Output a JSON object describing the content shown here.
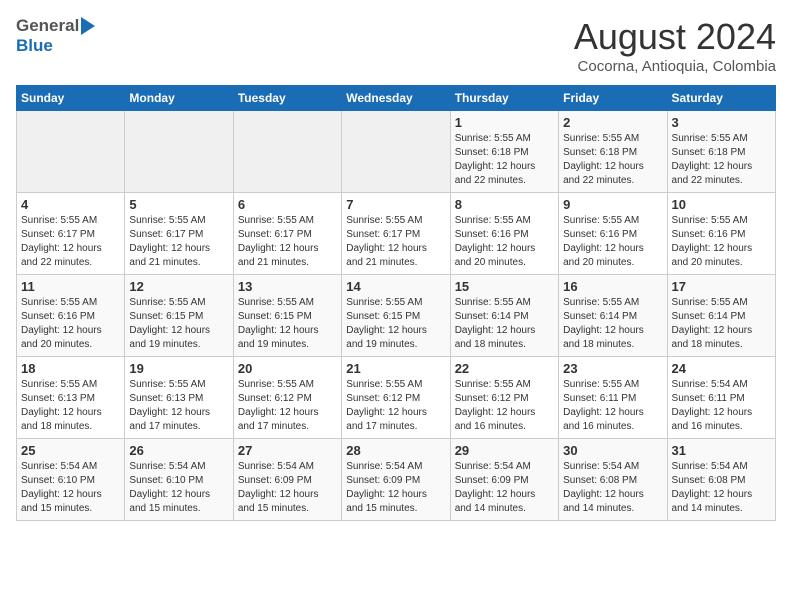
{
  "header": {
    "logo_general": "General",
    "logo_blue": "Blue",
    "month_title": "August 2024",
    "location": "Cocorna, Antioquia, Colombia"
  },
  "days_of_week": [
    "Sunday",
    "Monday",
    "Tuesday",
    "Wednesday",
    "Thursday",
    "Friday",
    "Saturday"
  ],
  "weeks": [
    [
      {
        "day": "",
        "info": ""
      },
      {
        "day": "",
        "info": ""
      },
      {
        "day": "",
        "info": ""
      },
      {
        "day": "",
        "info": ""
      },
      {
        "day": "1",
        "info": "Sunrise: 5:55 AM\nSunset: 6:18 PM\nDaylight: 12 hours\nand 22 minutes."
      },
      {
        "day": "2",
        "info": "Sunrise: 5:55 AM\nSunset: 6:18 PM\nDaylight: 12 hours\nand 22 minutes."
      },
      {
        "day": "3",
        "info": "Sunrise: 5:55 AM\nSunset: 6:18 PM\nDaylight: 12 hours\nand 22 minutes."
      }
    ],
    [
      {
        "day": "4",
        "info": "Sunrise: 5:55 AM\nSunset: 6:17 PM\nDaylight: 12 hours\nand 22 minutes."
      },
      {
        "day": "5",
        "info": "Sunrise: 5:55 AM\nSunset: 6:17 PM\nDaylight: 12 hours\nand 21 minutes."
      },
      {
        "day": "6",
        "info": "Sunrise: 5:55 AM\nSunset: 6:17 PM\nDaylight: 12 hours\nand 21 minutes."
      },
      {
        "day": "7",
        "info": "Sunrise: 5:55 AM\nSunset: 6:17 PM\nDaylight: 12 hours\nand 21 minutes."
      },
      {
        "day": "8",
        "info": "Sunrise: 5:55 AM\nSunset: 6:16 PM\nDaylight: 12 hours\nand 20 minutes."
      },
      {
        "day": "9",
        "info": "Sunrise: 5:55 AM\nSunset: 6:16 PM\nDaylight: 12 hours\nand 20 minutes."
      },
      {
        "day": "10",
        "info": "Sunrise: 5:55 AM\nSunset: 6:16 PM\nDaylight: 12 hours\nand 20 minutes."
      }
    ],
    [
      {
        "day": "11",
        "info": "Sunrise: 5:55 AM\nSunset: 6:16 PM\nDaylight: 12 hours\nand 20 minutes."
      },
      {
        "day": "12",
        "info": "Sunrise: 5:55 AM\nSunset: 6:15 PM\nDaylight: 12 hours\nand 19 minutes."
      },
      {
        "day": "13",
        "info": "Sunrise: 5:55 AM\nSunset: 6:15 PM\nDaylight: 12 hours\nand 19 minutes."
      },
      {
        "day": "14",
        "info": "Sunrise: 5:55 AM\nSunset: 6:15 PM\nDaylight: 12 hours\nand 19 minutes."
      },
      {
        "day": "15",
        "info": "Sunrise: 5:55 AM\nSunset: 6:14 PM\nDaylight: 12 hours\nand 18 minutes."
      },
      {
        "day": "16",
        "info": "Sunrise: 5:55 AM\nSunset: 6:14 PM\nDaylight: 12 hours\nand 18 minutes."
      },
      {
        "day": "17",
        "info": "Sunrise: 5:55 AM\nSunset: 6:14 PM\nDaylight: 12 hours\nand 18 minutes."
      }
    ],
    [
      {
        "day": "18",
        "info": "Sunrise: 5:55 AM\nSunset: 6:13 PM\nDaylight: 12 hours\nand 18 minutes."
      },
      {
        "day": "19",
        "info": "Sunrise: 5:55 AM\nSunset: 6:13 PM\nDaylight: 12 hours\nand 17 minutes."
      },
      {
        "day": "20",
        "info": "Sunrise: 5:55 AM\nSunset: 6:12 PM\nDaylight: 12 hours\nand 17 minutes."
      },
      {
        "day": "21",
        "info": "Sunrise: 5:55 AM\nSunset: 6:12 PM\nDaylight: 12 hours\nand 17 minutes."
      },
      {
        "day": "22",
        "info": "Sunrise: 5:55 AM\nSunset: 6:12 PM\nDaylight: 12 hours\nand 16 minutes."
      },
      {
        "day": "23",
        "info": "Sunrise: 5:55 AM\nSunset: 6:11 PM\nDaylight: 12 hours\nand 16 minutes."
      },
      {
        "day": "24",
        "info": "Sunrise: 5:54 AM\nSunset: 6:11 PM\nDaylight: 12 hours\nand 16 minutes."
      }
    ],
    [
      {
        "day": "25",
        "info": "Sunrise: 5:54 AM\nSunset: 6:10 PM\nDaylight: 12 hours\nand 15 minutes."
      },
      {
        "day": "26",
        "info": "Sunrise: 5:54 AM\nSunset: 6:10 PM\nDaylight: 12 hours\nand 15 minutes."
      },
      {
        "day": "27",
        "info": "Sunrise: 5:54 AM\nSunset: 6:09 PM\nDaylight: 12 hours\nand 15 minutes."
      },
      {
        "day": "28",
        "info": "Sunrise: 5:54 AM\nSunset: 6:09 PM\nDaylight: 12 hours\nand 15 minutes."
      },
      {
        "day": "29",
        "info": "Sunrise: 5:54 AM\nSunset: 6:09 PM\nDaylight: 12 hours\nand 14 minutes."
      },
      {
        "day": "30",
        "info": "Sunrise: 5:54 AM\nSunset: 6:08 PM\nDaylight: 12 hours\nand 14 minutes."
      },
      {
        "day": "31",
        "info": "Sunrise: 5:54 AM\nSunset: 6:08 PM\nDaylight: 12 hours\nand 14 minutes."
      }
    ]
  ]
}
